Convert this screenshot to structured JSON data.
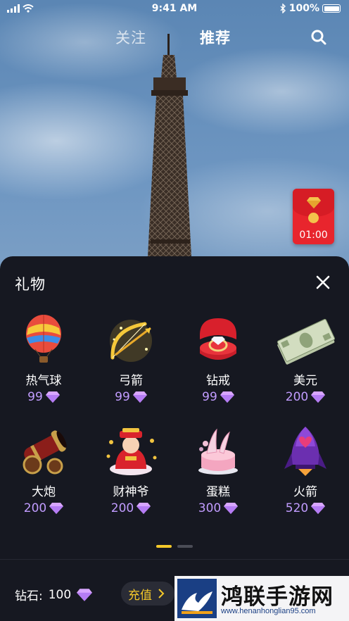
{
  "status_bar": {
    "time": "9:41 AM",
    "battery": "100%"
  },
  "nav": {
    "follow": "关注",
    "recommend": "推荐"
  },
  "red_packet": {
    "timer": "01:00"
  },
  "gift_panel": {
    "title": "礼物",
    "gifts": [
      {
        "name": "热气球",
        "price": "99",
        "icon": "hot-air-balloon-icon"
      },
      {
        "name": "弓箭",
        "price": "99",
        "icon": "bow-arrow-icon"
      },
      {
        "name": "钻戒",
        "price": "99",
        "icon": "diamond-ring-icon"
      },
      {
        "name": "美元",
        "price": "200",
        "icon": "dollar-bills-icon"
      },
      {
        "name": "大炮",
        "price": "200",
        "icon": "cannon-icon"
      },
      {
        "name": "财神爷",
        "price": "200",
        "icon": "god-of-wealth-icon"
      },
      {
        "name": "蛋糕",
        "price": "300",
        "icon": "cake-icon"
      },
      {
        "name": "火箭",
        "price": "520",
        "icon": "rocket-icon"
      }
    ],
    "page_count": 2,
    "current_page": 1
  },
  "footer": {
    "balance_label": "钻石:",
    "balance_value": "100",
    "recharge_label": "充值"
  },
  "watermark": {
    "text": "鸿联手游网",
    "url": "www.henanhonglian95.com"
  },
  "colors": {
    "sheet_bg": "#161821",
    "price": "#c19cff",
    "accent_yellow": "#f4c82a",
    "red_packet": "#e8252d"
  }
}
